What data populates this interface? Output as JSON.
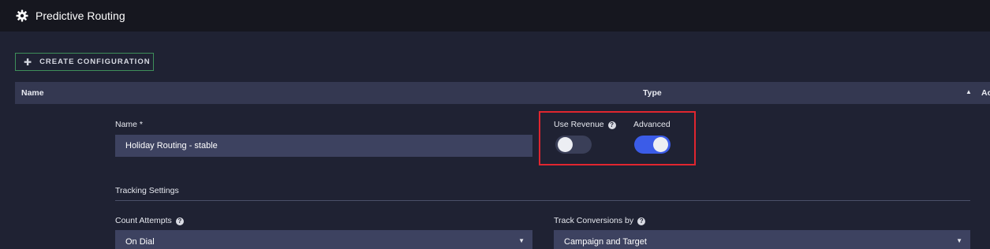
{
  "header": {
    "title": "Predictive Routing",
    "icon": "gear-icon"
  },
  "actions": {
    "create_label": "CREATE CONFIGURATION"
  },
  "table": {
    "columns": [
      "Name",
      "Type",
      "Ac"
    ],
    "sort_indicator": "▲"
  },
  "form": {
    "name_label": "Name *",
    "name_value": "Holiday Routing - stable",
    "use_revenue_label": "Use Revenue",
    "use_revenue_on": false,
    "advanced_label": "Advanced",
    "advanced_on": true,
    "tracking_settings_label": "Tracking Settings",
    "count_attempts_label": "Count Attempts",
    "count_attempts_value": "On Dial",
    "track_conversions_label": "Track Conversions by",
    "track_conversions_value": "Campaign and Target"
  },
  "colors": {
    "accent": "#3b5ce8",
    "highlight": "#e0262f",
    "button_border": "#3e8f5a"
  }
}
